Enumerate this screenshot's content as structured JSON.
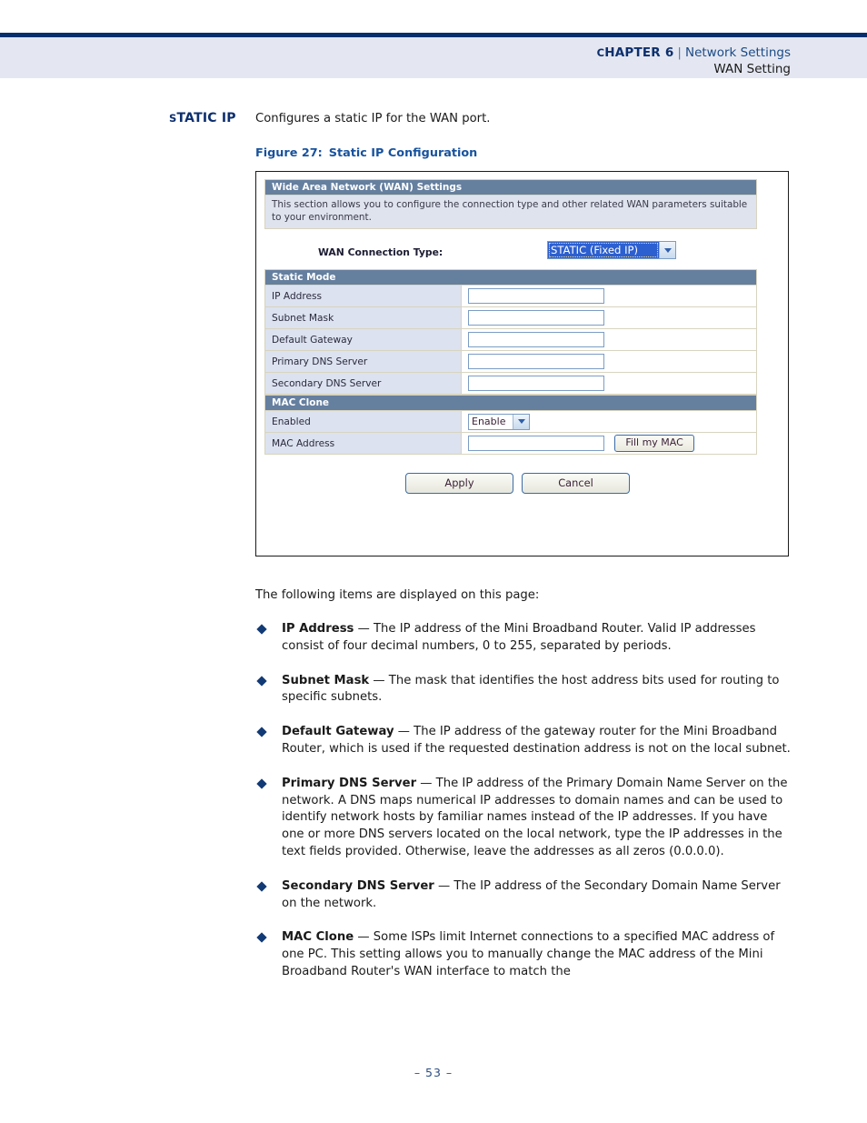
{
  "header": {
    "chapter_small_caps": "C",
    "chapter_rest": "HAPTER",
    "chapter_label": "Chapter 6",
    "chapter_number": "6",
    "separator": "|",
    "section": "Network Settings",
    "subsection": "WAN Setting"
  },
  "side_heading": {
    "first_letter": "S",
    "rest": "TATIC",
    "second_word": "IP",
    "full": "Static IP"
  },
  "intro": "Configures a static IP for the WAN port.",
  "figure": {
    "caption_number": "Figure 27:",
    "caption_title": "Static IP Configuration",
    "panel": {
      "section_title": "Wide Area Network (WAN) Settings",
      "description": "This section allows you to configure the connection type and other related WAN parameters suitable to your environment.",
      "wan_connection_label": "WAN Connection Type:",
      "wan_connection_value": "STATIC (Fixed IP)",
      "static_mode_title": "Static Mode",
      "static_rows": [
        {
          "label": "IP Address",
          "value": ""
        },
        {
          "label": "Subnet Mask",
          "value": ""
        },
        {
          "label": "Default Gateway",
          "value": ""
        },
        {
          "label": "Primary DNS Server",
          "value": ""
        },
        {
          "label": "Secondary DNS Server",
          "value": ""
        }
      ],
      "mac_clone_title": "MAC Clone",
      "mac_enabled_label": "Enabled",
      "mac_enabled_value": "Enable",
      "mac_address_label": "MAC Address",
      "mac_address_value": "",
      "fill_my_mac_label": "Fill my MAC",
      "apply_label": "Apply",
      "cancel_label": "Cancel"
    }
  },
  "body": {
    "intro": "The following items are displayed on this page:",
    "bullets": [
      {
        "term": "IP Address",
        "dash": " — ",
        "text": "The IP address of the Mini Broadband Router. Valid IP addresses consist of four decimal numbers, 0 to 255, separated by periods."
      },
      {
        "term": "Subnet Mask",
        "dash": " — ",
        "text": "The mask that identifies the host address bits used for routing to specific subnets."
      },
      {
        "term": "Default Gateway",
        "dash": " — ",
        "text": "The IP address of the gateway router for the Mini Broadband Router, which is used if the requested destination address is not on the local subnet."
      },
      {
        "term": "Primary DNS Server",
        "dash": " — ",
        "text": "The IP address of the Primary Domain Name Server on the network. A DNS maps numerical IP addresses to domain names and can be used to identify network hosts by familiar names instead of the IP addresses. If you have one or more DNS servers located on the local network, type the IP addresses in the text fields provided. Otherwise, leave the addresses as all zeros (0.0.0.0)."
      },
      {
        "term": "Secondary DNS Server",
        "dash": " — ",
        "text": "The IP address of the Secondary Domain Name Server on the network."
      },
      {
        "term": "MAC Clone",
        "dash": " — ",
        "text": "Some ISPs limit Internet connections to a specified MAC address of one PC. This setting allows you to manually change the MAC address of the Mini Broadband Router's WAN interface to match the"
      }
    ]
  },
  "footer": {
    "page_marker": "–  53  –"
  },
  "colors": {
    "accent_navy": "#062f6e",
    "header_band": "#e4e7f1",
    "caption_blue": "#17529e",
    "panel_title_bar": "#657f9f",
    "panel_label_cell": "#dce2ef",
    "select_highlight": "#2c5fd0"
  }
}
